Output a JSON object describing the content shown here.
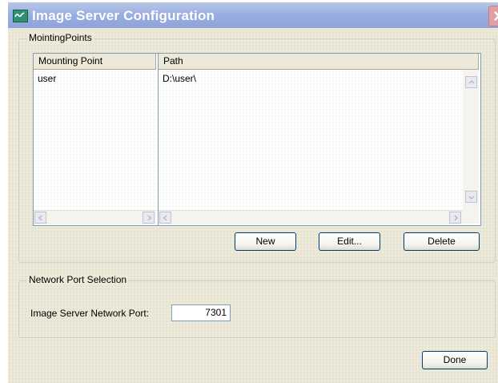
{
  "window": {
    "title": "Image Server Configuration"
  },
  "mounting_points": {
    "group_label": "MointingPoints",
    "columns": [
      "Mounting Point",
      "Path"
    ],
    "rows": [
      {
        "mount": "user",
        "path": "D:\\user\\"
      }
    ]
  },
  "buttons": {
    "new_label": "New",
    "edit_label": "Edit...",
    "delete_label": "Delete",
    "done_label": "Done"
  },
  "network": {
    "group_label": "Network Port Selection",
    "port_label": "Image Server Network Port:",
    "port_value": "7301"
  },
  "icons": {
    "app": "app-logo-icon",
    "close": "close-icon",
    "scroll_up": "scroll-up-icon",
    "scroll_down": "scroll-down-icon",
    "scroll_left": "scroll-left-icon",
    "scroll_right": "scroll-right-icon"
  },
  "colors": {
    "title_bar": "#98ade0",
    "dialog_bg": "#ece9d8",
    "button_border": "#003c74"
  }
}
